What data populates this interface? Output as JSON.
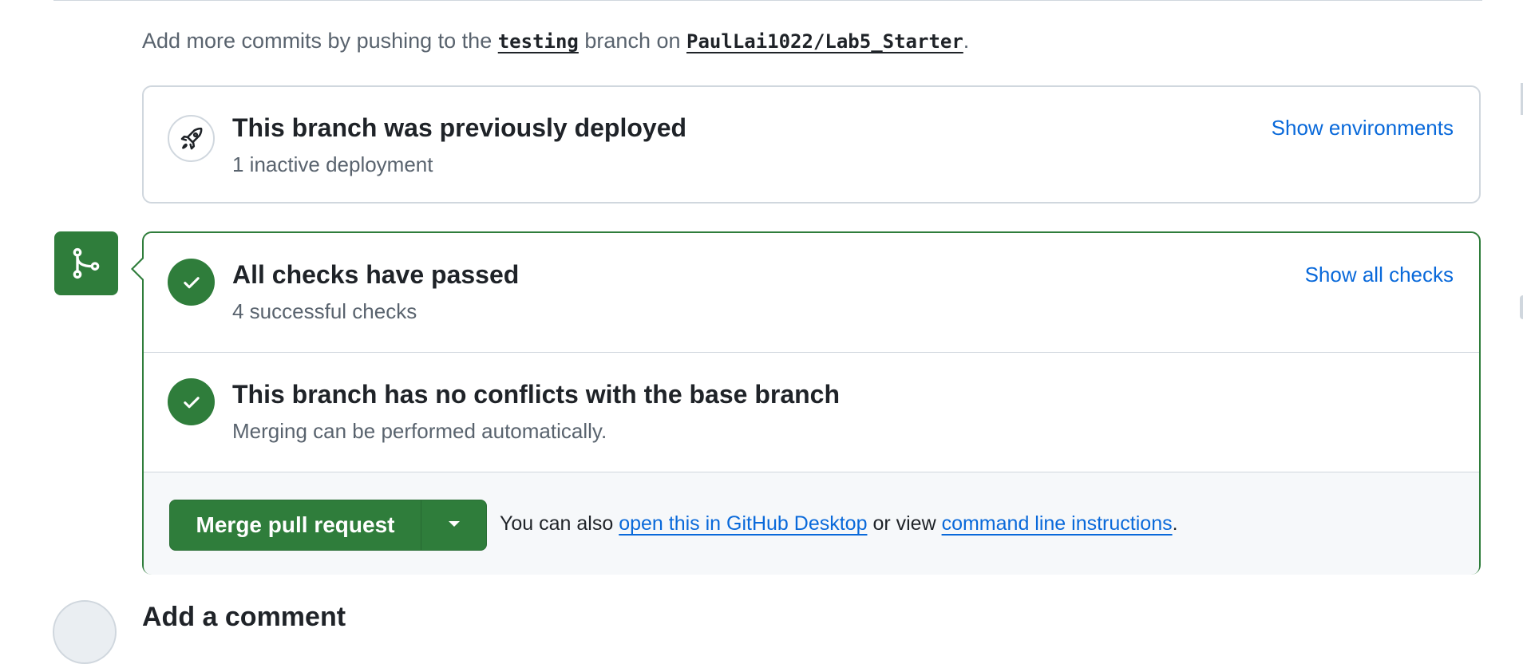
{
  "push_hint": {
    "prefix": "Add more commits by pushing to the",
    "branch": "testing",
    "middle": "branch on",
    "repo": "PaulLai1022/Lab5_Starter",
    "suffix": "."
  },
  "deployment": {
    "icon": "rocket-icon",
    "title": "This branch was previously deployed",
    "subtitle": "1 inactive deployment",
    "action": "Show environments"
  },
  "merge_box": {
    "avatar_icon": "git-merge-icon",
    "border_color": "#2f7d3b",
    "checks": {
      "title": "All checks have passed",
      "subtitle": "4 successful checks",
      "action": "Show all checks"
    },
    "conflicts": {
      "title": "This branch has no conflicts with the base branch",
      "subtitle": "Merging can be performed automatically."
    },
    "merge": {
      "button_label": "Merge pull request",
      "note_prefix": "You can also",
      "desktop_link": "open this in GitHub Desktop",
      "note_middle": "or view",
      "cli_link": "command line instructions",
      "note_suffix": "."
    }
  },
  "comment_section": {
    "heading": "Add a comment"
  },
  "colors": {
    "accent_link": "#0969da",
    "success": "#2f7d3b",
    "border": "#d0d7de",
    "muted_text": "#59636e"
  }
}
